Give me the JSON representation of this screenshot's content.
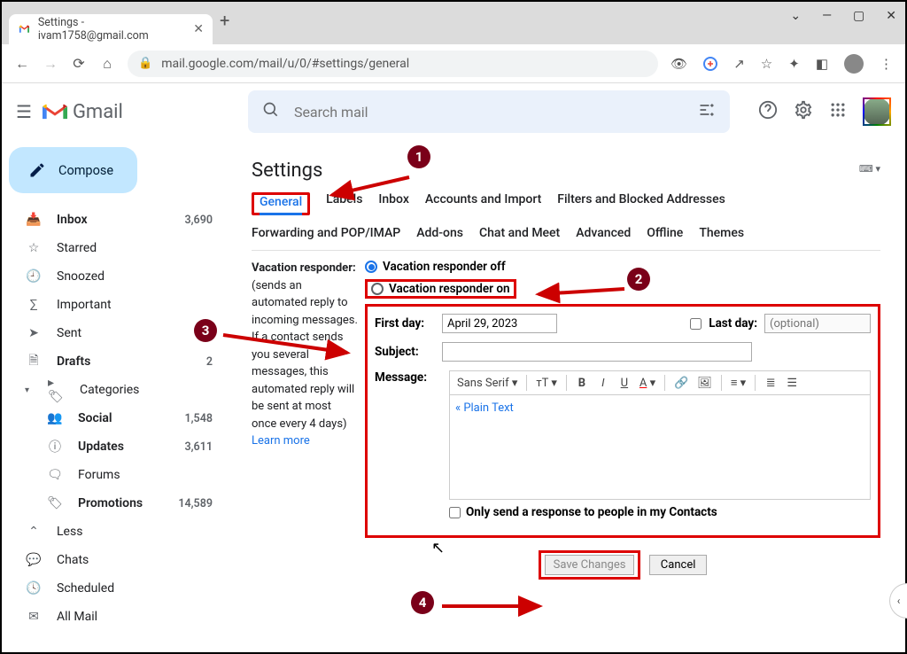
{
  "browser": {
    "tab_title": "Settings - ivam1758@gmail.com",
    "url": "mail.google.com/mail/u/0/#settings/general"
  },
  "header": {
    "logo_text": "Gmail",
    "search_placeholder": "Search mail"
  },
  "sidebar": {
    "compose": "Compose",
    "items": [
      {
        "label": "Inbox",
        "count": "3,690",
        "bold": true
      },
      {
        "label": "Starred",
        "count": ""
      },
      {
        "label": "Snoozed",
        "count": ""
      },
      {
        "label": "Important",
        "count": ""
      },
      {
        "label": "Sent",
        "count": ""
      },
      {
        "label": "Drafts",
        "count": "2",
        "bold": true
      },
      {
        "label": "Categories",
        "count": ""
      },
      {
        "label": "Social",
        "count": "1,548",
        "bold": true,
        "sub": true
      },
      {
        "label": "Updates",
        "count": "3,611",
        "bold": true,
        "sub": true
      },
      {
        "label": "Forums",
        "count": "",
        "sub": true
      },
      {
        "label": "Promotions",
        "count": "14,589",
        "bold": true,
        "sub": true
      },
      {
        "label": "Less",
        "count": ""
      },
      {
        "label": "Chats",
        "count": ""
      },
      {
        "label": "Scheduled",
        "count": ""
      },
      {
        "label": "All Mail",
        "count": ""
      }
    ]
  },
  "settings": {
    "title": "Settings",
    "tabs": [
      "General",
      "Labels",
      "Inbox",
      "Accounts and Import",
      "Filters and Blocked Addresses",
      "Forwarding and POP/IMAP",
      "Add-ons",
      "Chat and Meet",
      "Advanced",
      "Offline",
      "Themes"
    ],
    "vacation": {
      "heading": "Vacation responder:",
      "help": "(sends an automated reply to incoming messages. If a contact sends you several messages, this automated reply will be sent at most once every 4 days)",
      "learn": "Learn more",
      "off_label": "Vacation responder off",
      "on_label": "Vacation responder on",
      "first_day_label": "First day:",
      "first_day_value": "April 29, 2023",
      "last_day_label": "Last day:",
      "last_day_placeholder": "(optional)",
      "subject_label": "Subject:",
      "message_label": "Message:",
      "font_family": "Sans Serif",
      "plain_text": "« Plain Text",
      "contacts_only": "Only send a response to people in my Contacts"
    },
    "save": "Save Changes",
    "cancel": "Cancel"
  },
  "annotations": [
    "1",
    "2",
    "3",
    "4"
  ]
}
